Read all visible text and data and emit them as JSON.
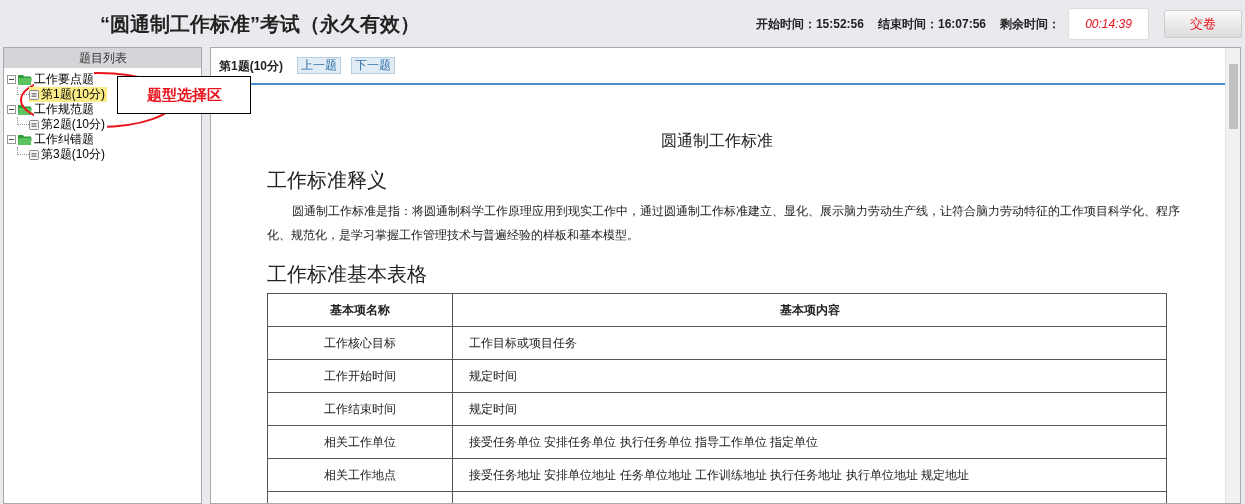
{
  "header": {
    "title": "“圆通制工作标准”考试（永久有效）",
    "start_label": "开始时间：",
    "start_time": "15:52:56",
    "end_label": "结束时间：",
    "end_time": "16:07:56",
    "remaining_label": "剩余时间：",
    "remaining_time": "00:14:39",
    "submit_button": "交卷"
  },
  "sidebar": {
    "title": "题目列表",
    "tree": [
      {
        "label": "工作要点题",
        "expanded": true,
        "children": [
          {
            "label": "第1题(10分)",
            "selected": true
          }
        ]
      },
      {
        "label": "工作规范题",
        "expanded": true,
        "children": [
          {
            "label": "第2题(10分)",
            "selected": false
          }
        ]
      },
      {
        "label": "工作纠错题",
        "expanded": true,
        "children": [
          {
            "label": "第3题(10分)",
            "selected": false
          }
        ]
      }
    ]
  },
  "annotation": {
    "label": "题型选择区"
  },
  "question_bar": {
    "current": "第1题(10分)",
    "prev_button": "上一题",
    "next_button": "下一题"
  },
  "document": {
    "title": "圆通制工作标准",
    "sections": [
      {
        "kind": "paragraph",
        "heading": "工作标准释义",
        "text": "圆通制工作标准是指：将圆通制科学工作原理应用到现实工作中，通过圆通制工作标准建立、显化、展示脑力劳动生产线，让符合脑力劳动特征的工作项目科学化、程序化、规范化，是学习掌握工作管理技术与普遍经验的样板和基本模型。"
      },
      {
        "kind": "table",
        "heading": "工作标准基本表格",
        "columns": [
          "基本项名称",
          "基本项内容"
        ],
        "rows": [
          [
            "工作核心目标",
            "工作目标或项目任务"
          ],
          [
            "工作开始时间",
            "规定时间"
          ],
          [
            "工作结束时间",
            "规定时间"
          ],
          [
            "相关工作单位",
            "接受任务单位 安排任务单位 执行任务单位 指导工作单位 指定单位"
          ],
          [
            "相关工作地点",
            "接受任务地址 安排单位地址 任务单位地址 工作训练地址 执行任务地址 执行单位地址 规定地址"
          ]
        ]
      }
    ]
  }
}
